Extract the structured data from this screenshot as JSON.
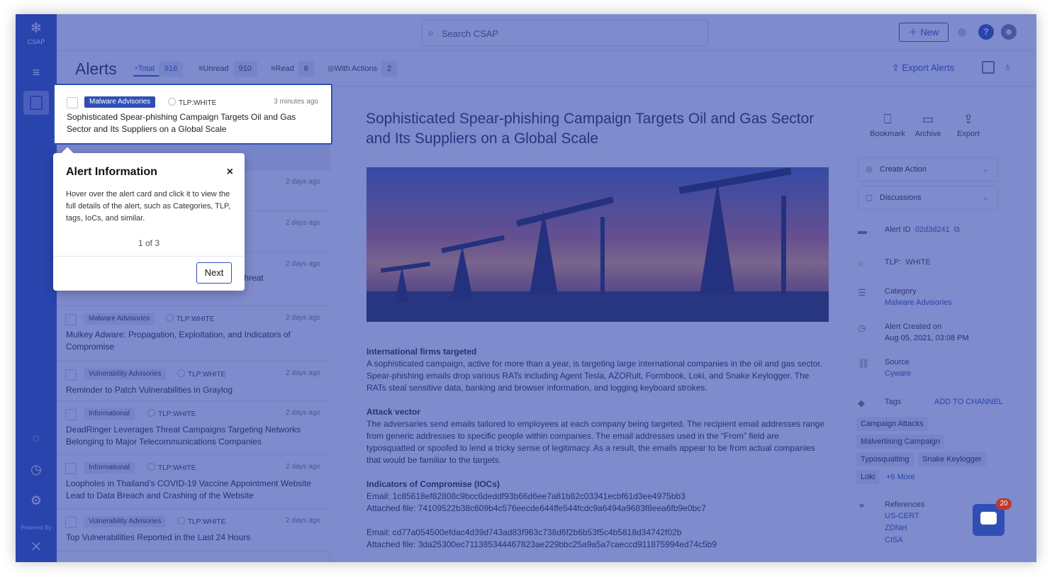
{
  "app": {
    "logo_text": "CSAP",
    "powered_by": "Powered By"
  },
  "topbar": {
    "search_placeholder": "Search CSAP",
    "new_label": "New"
  },
  "subbar": {
    "title": "Alerts",
    "stats": [
      {
        "label": "Total",
        "count": "916"
      },
      {
        "label": "Unread",
        "count": "910"
      },
      {
        "label": "Read",
        "count": "6"
      },
      {
        "label": "With Actions",
        "count": "2"
      }
    ],
    "export_label": "Export Alerts"
  },
  "alerts": [
    {
      "category": "Malware Advisories",
      "tlp": "TLP:WHITE",
      "time": "3 minutes ago",
      "title": "Sophisticated Spear-phishing Campaign Targets Oil and Gas Sector and Its Suppliers on a Global Scale"
    },
    {
      "category": "",
      "tlp": "",
      "time": "2 days ago",
      "title": ""
    },
    {
      "category": "",
      "tlp": "",
      "time": "2 days ago",
      "title": ""
    },
    {
      "category": "",
      "tlp": "",
      "time": "2 days ago",
      "title": "Inside the House – Understanding the Insider Threat"
    },
    {
      "category": "Malware Advisories",
      "tlp": "TLP:WHITE",
      "time": "2 days ago",
      "title": "Mulkey Adware: Propagation, Exploitation, and Indicators of Compromise"
    },
    {
      "category": "Vulnerability Advisories",
      "tlp": "TLP:WHITE",
      "time": "2 days ago",
      "title": "Reminder to Patch Vulnerabilities in Graylog"
    },
    {
      "category": "Informational",
      "tlp": "TLP:WHITE",
      "time": "2 days ago",
      "title": "DeadRinger Leverages Threat Campaigns Targeting Networks Belonging to Major Telecommunications Companies"
    },
    {
      "category": "Informational",
      "tlp": "TLP:WHITE",
      "time": "2 days ago",
      "title": "Loopholes in Thailand’s COVID-19 Vaccine Appointment Website Lead to Data Breach and Crashing of the Website"
    },
    {
      "category": "Vulnerability Advisories",
      "tlp": "TLP:WHITE",
      "time": "2 days ago",
      "title": "Top Vulnerabilities Reported in the Last 24 Hours"
    }
  ],
  "detail": {
    "title": "Sophisticated Spear-phishing Campaign Targets Oil and Gas Sector and Its Suppliers on a Global Scale",
    "sections": [
      {
        "heading": "International firms targeted",
        "text": "A sophisticated campaign, active for more than a year, is targeting large international companies in the oil and gas sector. Spear-phishing emails drop various RATs including Agent Tesla, AZORult, Formbook, Loki, and Snake Keylogger. The RATs steal sensitive data, banking and browser information, and logging keyboard strokes."
      },
      {
        "heading": "Attack vector",
        "text": "The adversaries send emails tailored to employees at each company being targeted. The recipient email addresses range from generic addresses to specific people within companies. The email addresses used in the “From” field are typosquatted or spoofed to lend a tricky sense of legitimacy. As a result, the emails appear to be from actual companies that would be familiar to the targets."
      }
    ],
    "ioc_heading": "Indicators of Compromise (IOCs)",
    "ioc_lines_1": [
      "Email: 1c85618ef82808c9bcc6deddf93b66d6ee7a81b82c03341ecbf61d3ee4975bb3",
      "Attached file: 74109522b38c609b4c576eecde644ffe544fcdc9a6494a9683f8eea6fb9e0bc7"
    ],
    "ioc_lines_2": [
      "Email: cd77a054500efdac4d39d743ad83f963c738d6f2b6b53f5c4b5818d34742f02b",
      "Attached file: 3da25300ec711385344467823ae229bbc25a9a5a7caeccd911875994ed74c5b9"
    ]
  },
  "rpanel": {
    "actions": [
      "Bookmark",
      "Archive",
      "Export"
    ],
    "create_action": "Create Action",
    "discussions": "Discussions",
    "alert_id_label": "Alert ID",
    "alert_id": "02d3d241",
    "tlp_label": "TLP:",
    "tlp_value": "WHITE",
    "category_label": "Category",
    "category_value": "Malware Advisories",
    "created_label": "Alert Created on",
    "created_value": "Aug 05, 2021, 03:08 PM",
    "source_label": "Source",
    "source_value": "Cyware",
    "tags_label": "Tags",
    "add_to_channel": "ADD TO CHANNEL",
    "tags": [
      "Campaign Attacks",
      "Malvertising Campaign",
      "Typosquatting",
      "Snake Keylogger",
      "Loki"
    ],
    "more_tags": "+6 More",
    "references_label": "References",
    "references": [
      "US-CERT",
      "ZDNet",
      "CISA"
    ]
  },
  "tour": {
    "title": "Alert Information",
    "close": "×",
    "body": "Hover over the alert card and click it to view the full details of the alert, such as Categories, TLP, tags, IoCs, and similar.",
    "step": "1 of 3",
    "next": "Next"
  },
  "chat": {
    "badge": "20"
  },
  "colors": {
    "brand": "#2f4fb4",
    "overlay": "#283eaa"
  }
}
